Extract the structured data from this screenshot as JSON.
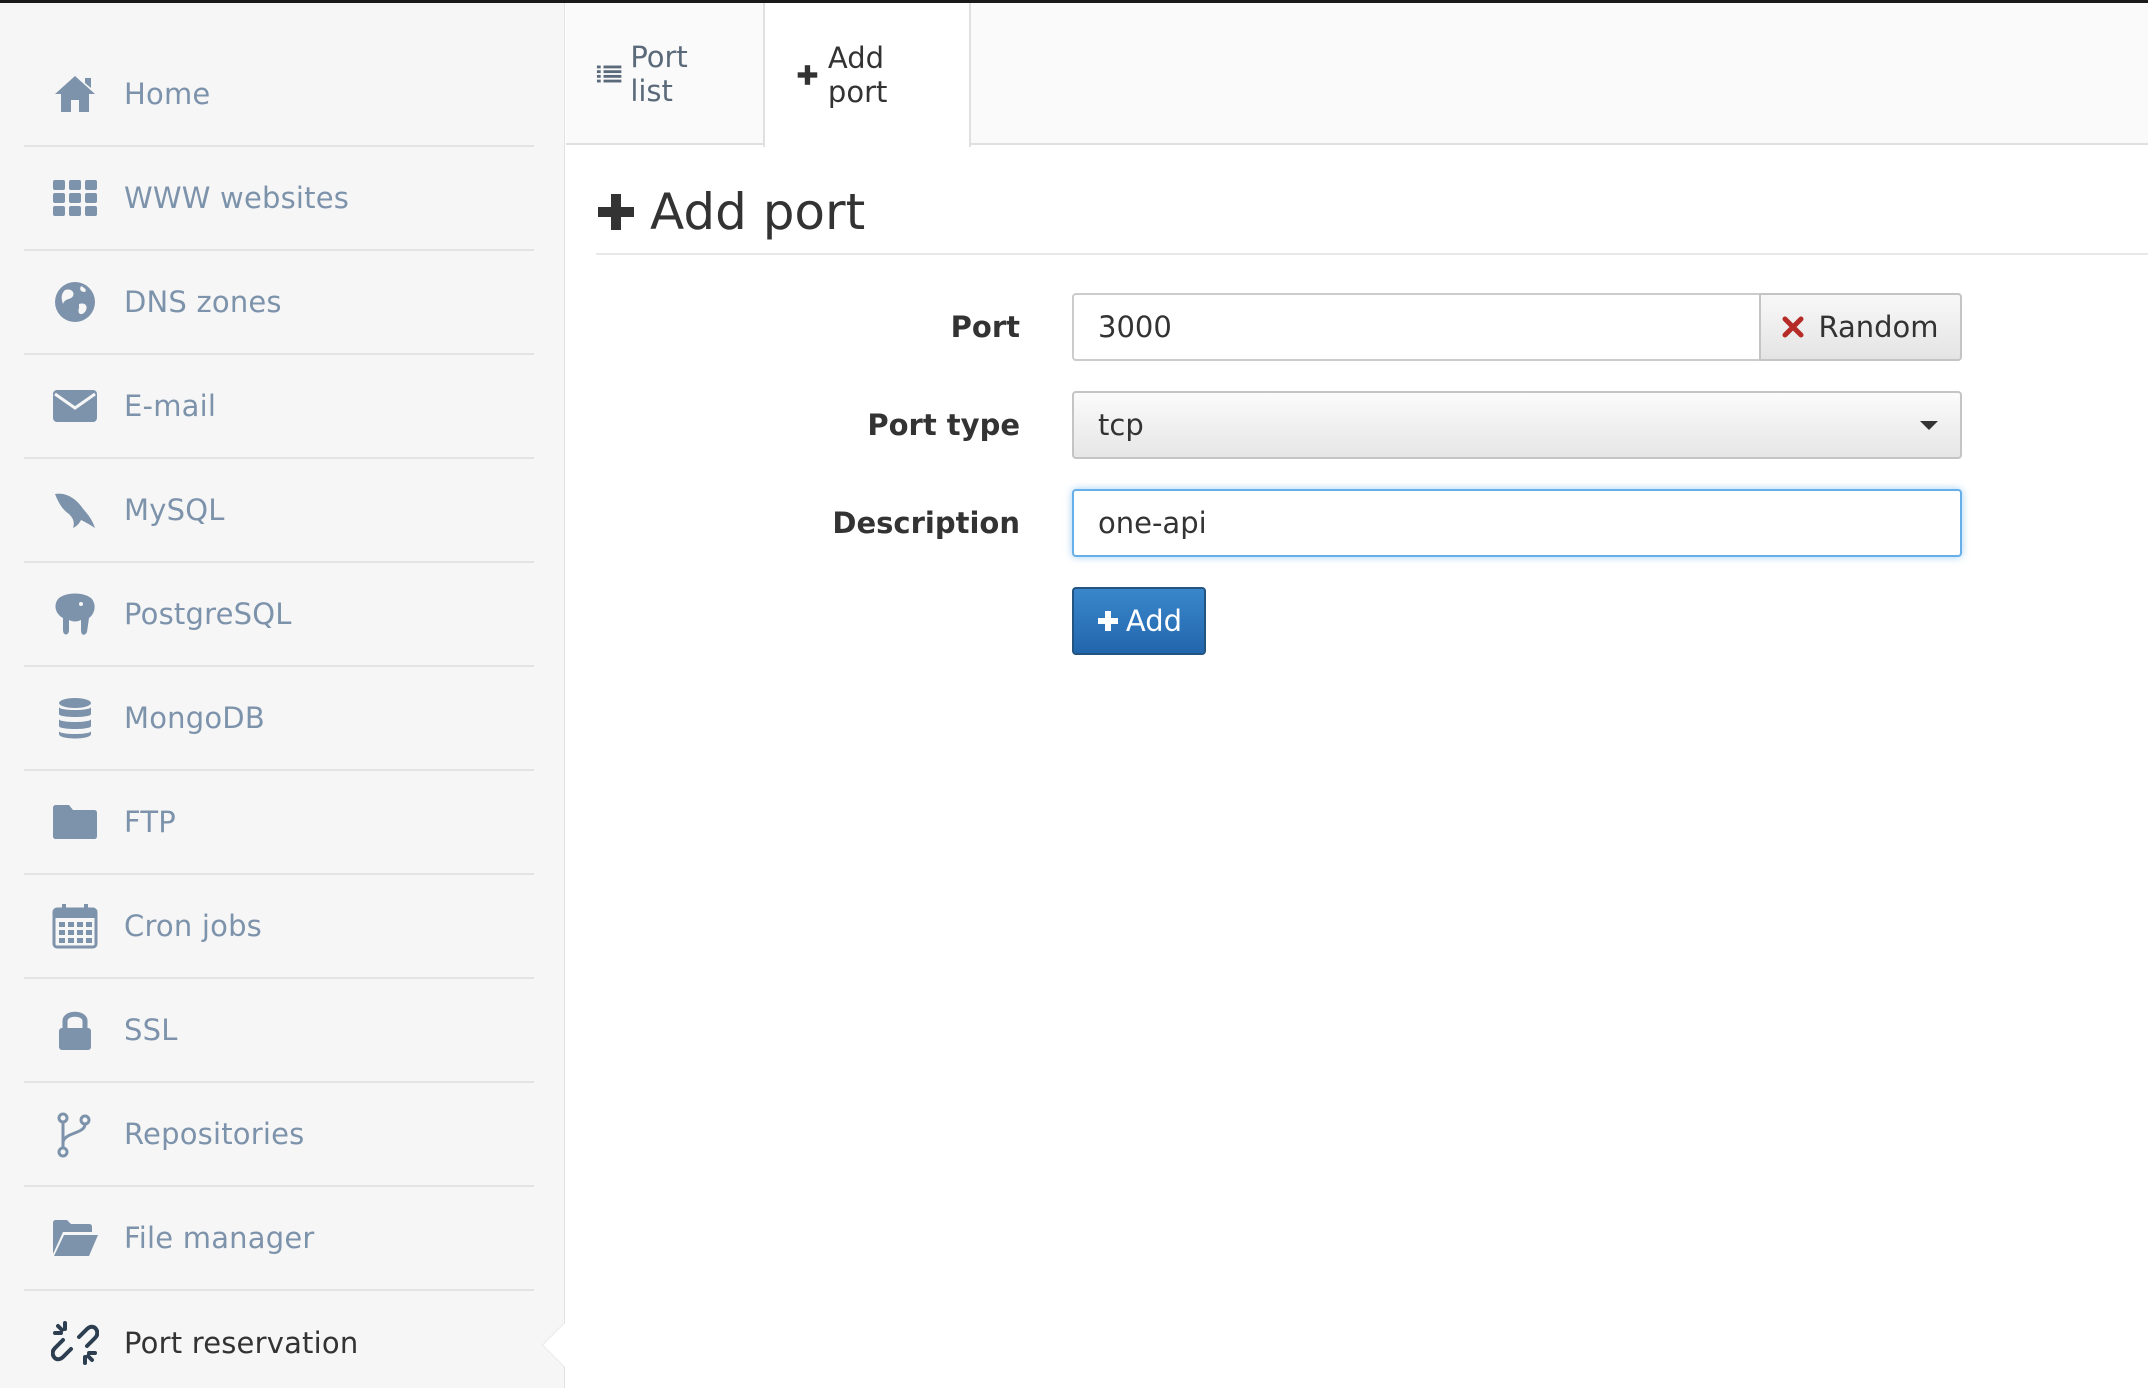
{
  "sidebar": {
    "items": [
      {
        "label": "Home",
        "icon": "home-icon"
      },
      {
        "label": "WWW websites",
        "icon": "grid-icon"
      },
      {
        "label": "DNS zones",
        "icon": "globe-icon"
      },
      {
        "label": "E-mail",
        "icon": "envelope-icon"
      },
      {
        "label": "MySQL",
        "icon": "dolphin-icon"
      },
      {
        "label": "PostgreSQL",
        "icon": "elephant-icon"
      },
      {
        "label": "MongoDB",
        "icon": "database-icon"
      },
      {
        "label": "FTP",
        "icon": "folder-icon"
      },
      {
        "label": "Cron jobs",
        "icon": "calendar-icon"
      },
      {
        "label": "SSL",
        "icon": "lock-icon"
      },
      {
        "label": "Repositories",
        "icon": "branch-icon"
      },
      {
        "label": "File manager",
        "icon": "folder-open-icon"
      },
      {
        "label": "Port reservation",
        "icon": "unlink-icon",
        "active": true
      }
    ]
  },
  "tabs": [
    {
      "label": "Port list",
      "icon": "list-icon"
    },
    {
      "label": "Add port",
      "icon": "plus-icon",
      "active": true
    }
  ],
  "page": {
    "title": "Add port"
  },
  "form": {
    "port_label": "Port",
    "port_value": "3000",
    "random_label": "Random",
    "port_type_label": "Port type",
    "port_type_value": "tcp",
    "description_label": "Description",
    "description_value": "one-api",
    "add_label": "Add"
  },
  "colors": {
    "sidebar_text": "#7d93ab",
    "primary_button": "#2a6fb6",
    "random_icon": "#b52b27",
    "focus_border": "#66afe9"
  }
}
